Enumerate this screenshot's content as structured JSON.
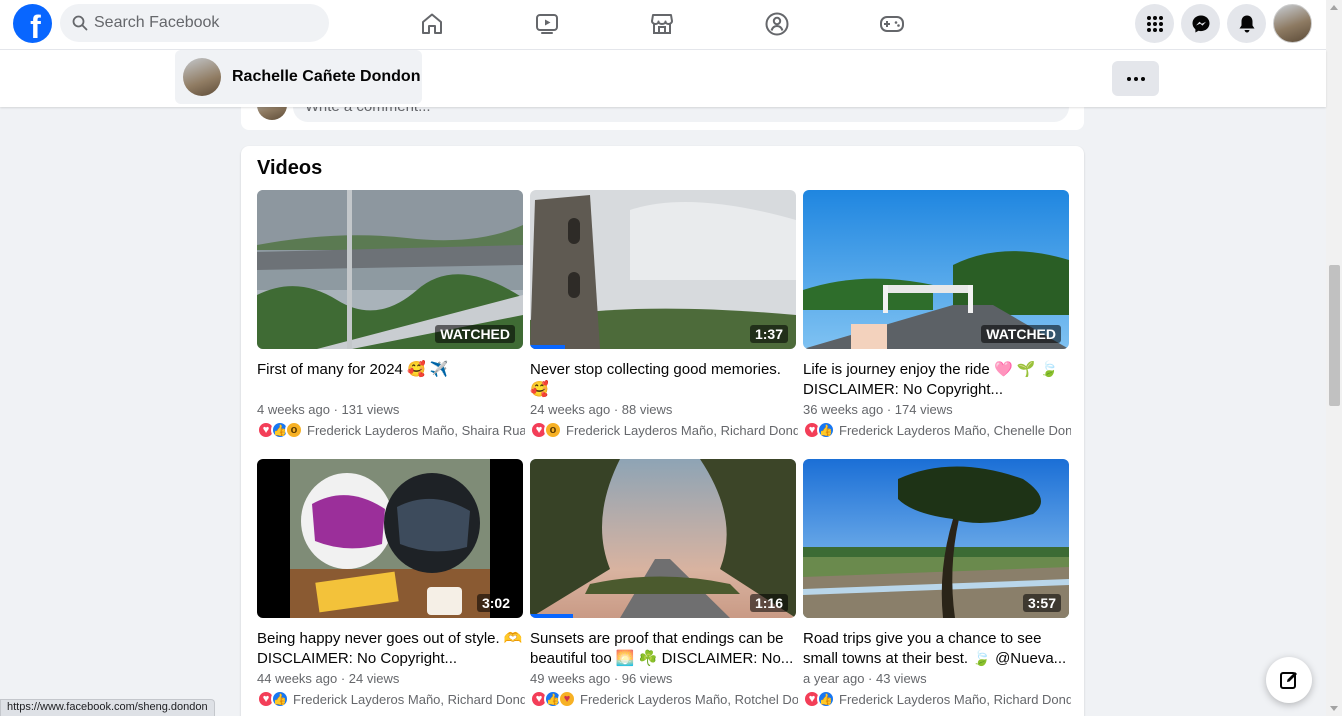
{
  "topbar": {
    "logo": "f",
    "search_placeholder": "Search Facebook",
    "nav_icons": [
      "home-icon",
      "watch-icon",
      "marketplace-icon",
      "groups-icon",
      "gaming-icon"
    ],
    "right_buttons": [
      "menu-grid-icon",
      "messenger-icon",
      "notifications-icon"
    ]
  },
  "profile": {
    "name": "Rachelle Cañete Dondon"
  },
  "comment": {
    "placeholder": "Write a comment..."
  },
  "videos": {
    "title": "Videos",
    "items": [
      {
        "title": "First of many for 2024 🥰 ✈️",
        "meta": "4 weeks ago · 131 views",
        "reactions": [
          "love",
          "like",
          "wow"
        ],
        "names": "Frederick Layderos Maño, Shaira Ruay",
        "badge": "WATCHED",
        "progress": 0
      },
      {
        "title": "Never stop collecting good memories. 🥰",
        "meta": "24 weeks ago · 88 views",
        "reactions": [
          "love",
          "wow"
        ],
        "names": "Frederick Layderos Maño, Richard Dondc",
        "badge": "1:37",
        "progress": 0.13
      },
      {
        "title": "Life is journey enjoy the ride 🩷 🌱 🍃 DISCLAIMER: No Copyright...",
        "meta": "36 weeks ago · 174 views",
        "reactions": [
          "love",
          "like"
        ],
        "names": "Frederick Layderos Maño, Chenelle Dond",
        "badge": "WATCHED",
        "progress": 0
      },
      {
        "title": "Being happy never goes out of style. 🫶 DISCLAIMER: No Copyright...",
        "meta": "44 weeks ago · 24 views",
        "reactions": [
          "love",
          "like"
        ],
        "names": "Frederick Layderos Maño, Richard Dondc",
        "badge": "3:02",
        "progress": 0
      },
      {
        "title": "Sunsets are proof that endings can be beautiful too 🌅 ☘️ DISCLAIMER: No...",
        "meta": "49 weeks ago · 96 views",
        "reactions": [
          "love",
          "like",
          "care"
        ],
        "names": "Frederick Layderos Maño, Rotchel Dor",
        "badge": "1:16",
        "progress": 0.16
      },
      {
        "title": "Road trips give you a chance to see small towns at their best. 🍃 @Nueva...",
        "meta": "a year ago · 43 views",
        "reactions": [
          "love",
          "like"
        ],
        "names": "Frederick Layderos Maño, Richard Dondc",
        "badge": "3:57",
        "progress": 0
      }
    ]
  },
  "status_url": "https://www.facebook.com/sheng.dondon",
  "colors": {
    "brand": "#0866ff",
    "page_bg": "#f0f2f5",
    "love": "#f33e58",
    "like": "#1877f2",
    "wow": "#f7b125"
  }
}
